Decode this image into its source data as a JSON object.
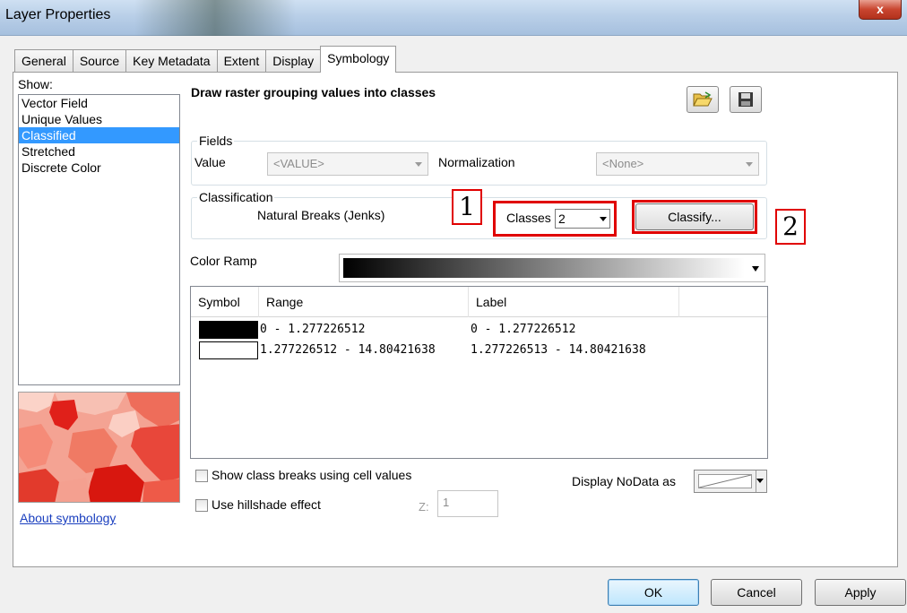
{
  "window": {
    "title": "Layer Properties",
    "close_label": "x"
  },
  "tabs": [
    {
      "label": "General"
    },
    {
      "label": "Source"
    },
    {
      "label": "Key Metadata"
    },
    {
      "label": "Extent"
    },
    {
      "label": "Display"
    },
    {
      "label": "Symbology"
    }
  ],
  "show": {
    "label": "Show:",
    "items": [
      {
        "label": "Vector Field"
      },
      {
        "label": "Unique Values"
      },
      {
        "label": "Classified"
      },
      {
        "label": "Stretched"
      },
      {
        "label": "Discrete Color"
      }
    ],
    "selected": "Classified"
  },
  "about_link": "About symbology",
  "heading": "Draw raster grouping values into classes",
  "icons": {
    "open": "folder-open-icon",
    "save": "floppy-save-icon"
  },
  "fields": {
    "group_label": "Fields",
    "value_label": "Value",
    "value": "<VALUE>",
    "normalization_label": "Normalization",
    "normalization": "<None>"
  },
  "classification": {
    "group_label": "Classification",
    "method": "Natural Breaks (Jenks)",
    "classes_label": "Classes",
    "classes_value": "2",
    "classify_button": "Classify..."
  },
  "callouts": {
    "one": "1",
    "two": "2"
  },
  "color_ramp": {
    "label": "Color Ramp",
    "start_color": "#000000",
    "end_color": "#ffffff"
  },
  "table": {
    "headers": {
      "symbol": "Symbol",
      "range": "Range",
      "label": "Label"
    },
    "rows": [
      {
        "color": "#000000",
        "range": "0 - 1.277226512",
        "label": "0 - 1.277226512"
      },
      {
        "color": "#ffffff",
        "range": "1.277226512 - 14.80421638",
        "label": "1.277226513 - 14.80421638"
      }
    ]
  },
  "options": {
    "show_breaks": "Show class breaks using cell values",
    "hillshade": "Use hillshade effect",
    "z_label": "Z:",
    "z_value": "1",
    "nodata_label": "Display NoData as"
  },
  "buttons": {
    "ok": "OK",
    "cancel": "Cancel",
    "apply": "Apply"
  }
}
